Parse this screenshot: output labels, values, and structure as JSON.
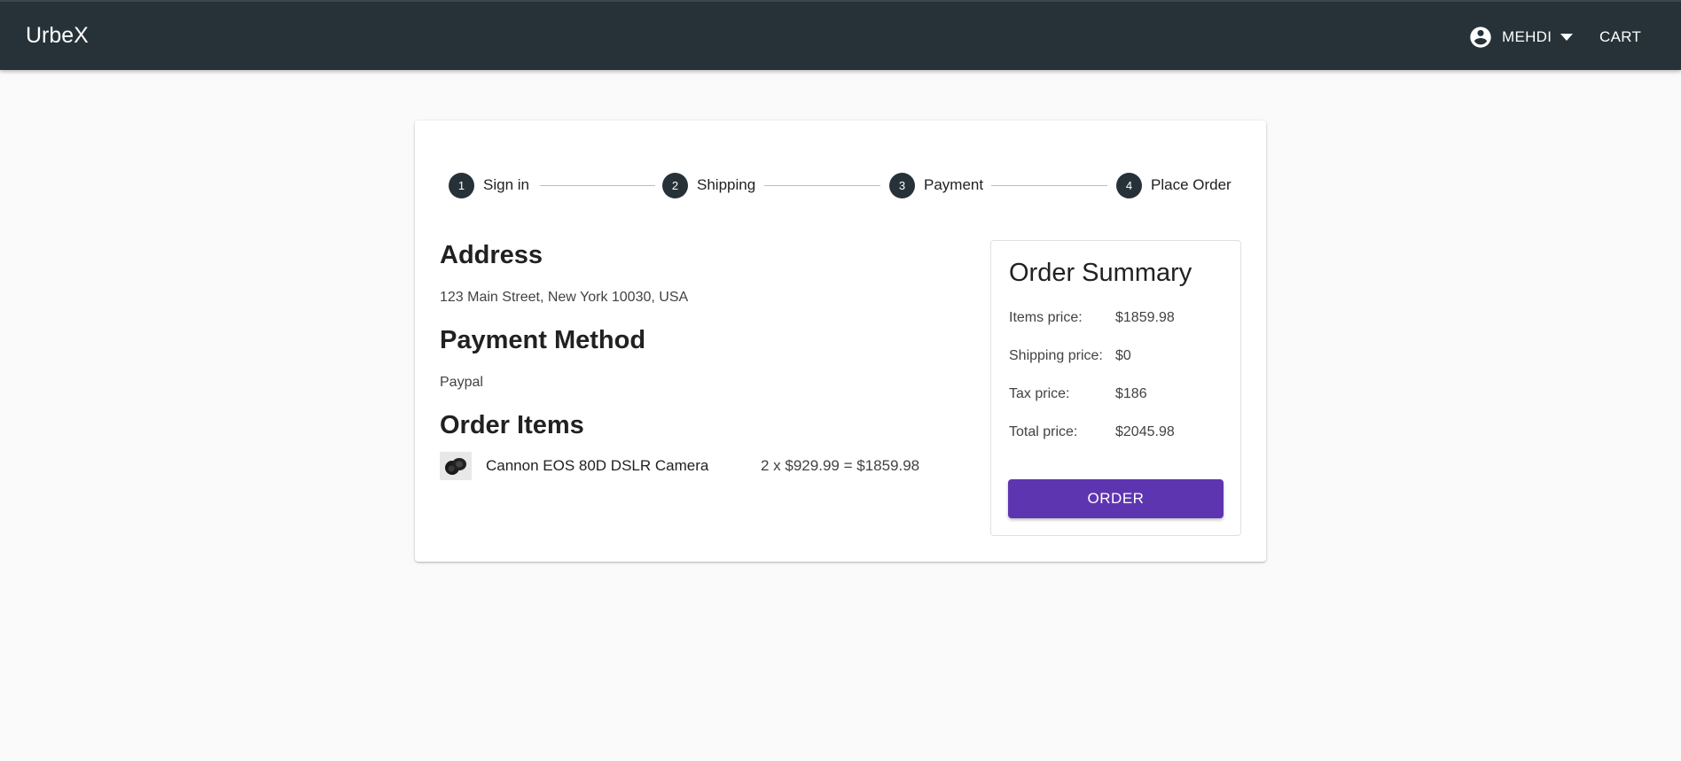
{
  "header": {
    "brand": "UrbeX",
    "user_name": "MEHDI",
    "cart_label": "CART"
  },
  "stepper": {
    "steps": [
      {
        "number": "1",
        "label": "Sign in"
      },
      {
        "number": "2",
        "label": "Shipping"
      },
      {
        "number": "3",
        "label": "Payment"
      },
      {
        "number": "4",
        "label": "Place Order"
      }
    ]
  },
  "address": {
    "title": "Address",
    "text": "123 Main Street, New York 10030, USA"
  },
  "payment": {
    "title": "Payment Method",
    "text": "Paypal"
  },
  "order_items": {
    "title": "Order Items",
    "items": [
      {
        "name": "Cannon EOS 80D DSLR Camera",
        "total": "2 x $929.99 = $1859.98"
      }
    ]
  },
  "summary": {
    "title": "Order Summary",
    "rows": [
      {
        "label": "Items price:",
        "value": "$1859.98"
      },
      {
        "label": "Shipping price:",
        "value": "$0"
      },
      {
        "label": "Tax price:",
        "value": "$186"
      },
      {
        "label": "Total price:",
        "value": "$2045.98"
      }
    ],
    "order_button": "ORDER"
  },
  "colors": {
    "appbar": "#263238",
    "accent": "#5e35b1",
    "background": "#fafafa"
  },
  "icons": [
    "account-circle-icon",
    "caret-down-icon",
    "camera-thumbnail"
  ]
}
